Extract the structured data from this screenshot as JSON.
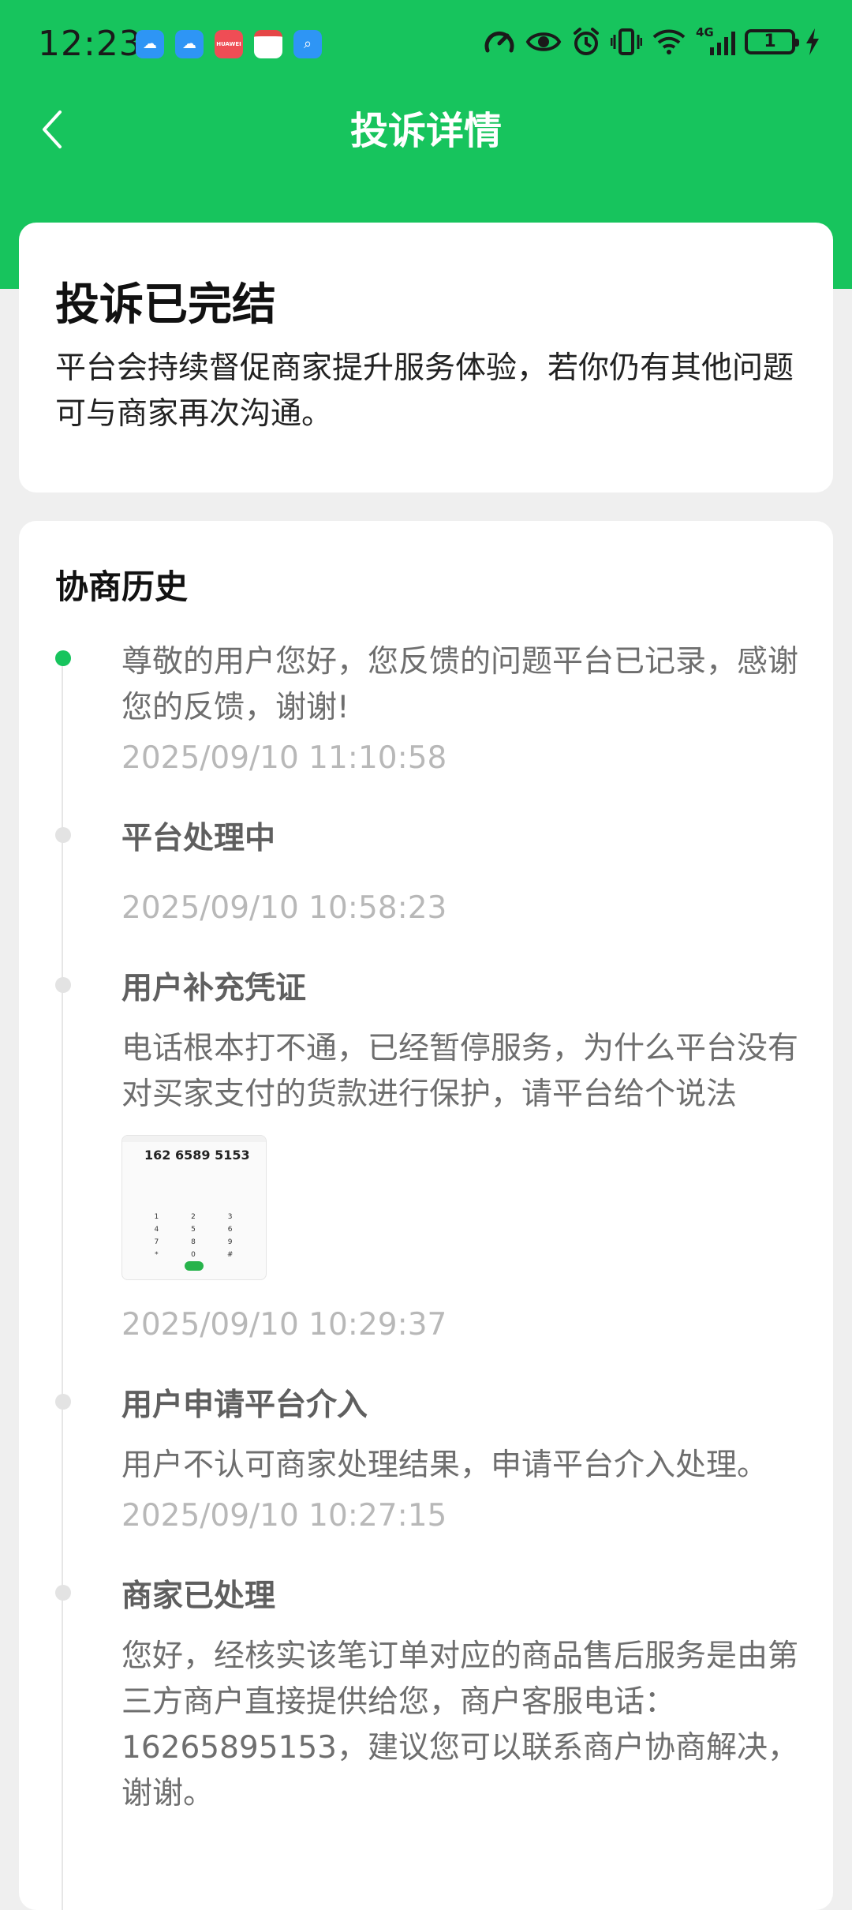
{
  "status_bar": {
    "time": "12:23",
    "app_icons": [
      "cloud-app-icon",
      "cloud-app-icon",
      "huawei-app-icon",
      "calendar-app-icon",
      "search-app-icon"
    ],
    "huawei_label": "HUAWEI",
    "system_icons": [
      "speed-icon",
      "eye-icon",
      "alarm-icon",
      "vibrate-icon",
      "wifi-icon",
      "signal-icon",
      "battery-icon",
      "charging-icon"
    ],
    "network_label": "4G",
    "battery_level": "1"
  },
  "nav": {
    "title": "投诉详情"
  },
  "status_card": {
    "title": "投诉已完结",
    "description": "平台会持续督促商家提升服务体验，若你仍有其他问题可与商家再次沟通。"
  },
  "history": {
    "title": "协商历史",
    "items": [
      {
        "text": "尊敬的用户您好，您反馈的问题平台已记录，感谢您的反馈，谢谢!",
        "time": "2025/09/10 11:10:58"
      },
      {
        "title": "平台处理中",
        "time": "2025/09/10 10:58:23"
      },
      {
        "title": "用户补充凭证",
        "detail": "电话根本打不通，已经暂停服务，为什么平台没有对买家支付的货款进行保护，请平台给个说法",
        "thumbnail_number": "162 6589 5153",
        "time": "2025/09/10 10:29:37"
      },
      {
        "title": "用户申请平台介入",
        "detail": "用户不认可商家处理结果，申请平台介入处理。",
        "time": "2025/09/10 10:27:15"
      },
      {
        "title": "商家已处理",
        "detail": "您好，经核实该笔订单对应的商品售后服务是由第三方商户直接提供给您，商户客服电话：16265895153，建议您可以联系商户协商解决，谢谢。"
      }
    ]
  },
  "colors": {
    "primary_green": "#17c45d",
    "background": "#efefef"
  }
}
